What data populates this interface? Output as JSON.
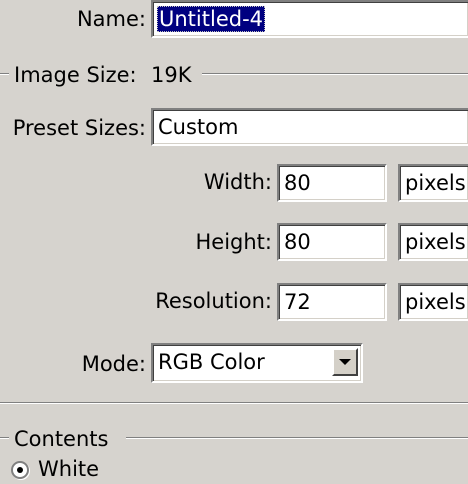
{
  "dialog": {
    "name": {
      "label": "Name:",
      "value": "Untitled-4"
    },
    "image_size": {
      "label": "Image Size:",
      "value": "19K"
    },
    "preset_sizes": {
      "label": "Preset Sizes:",
      "value": "Custom"
    },
    "width": {
      "label": "Width:",
      "value": "80",
      "unit": "pixels"
    },
    "height": {
      "label": "Height:",
      "value": "80",
      "unit": "pixels"
    },
    "resolution": {
      "label": "Resolution:",
      "value": "72",
      "unit": "pixels"
    },
    "mode": {
      "label": "Mode:",
      "value": "RGB Color"
    },
    "contents": {
      "label": "Contents",
      "options": [
        {
          "label": "White",
          "selected": true
        }
      ]
    }
  },
  "colors": {
    "dialog_bg": "#d6d3ce",
    "selection_bg": "#000080",
    "selection_text": "#ffffff"
  },
  "icons": {
    "dropdown": "chevron-down-icon"
  }
}
